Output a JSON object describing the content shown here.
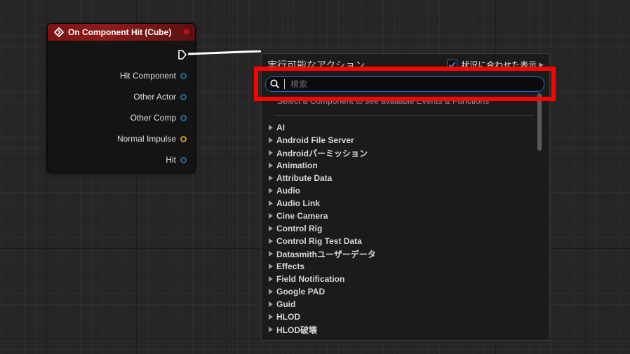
{
  "event_node": {
    "title": "On Component Hit (Cube)",
    "icon": "event-diamond-icon",
    "pins": [
      {
        "label": "Hit Component",
        "type": "object"
      },
      {
        "label": "Other Actor",
        "type": "object"
      },
      {
        "label": "Other Comp",
        "type": "object"
      },
      {
        "label": "Normal Impulse",
        "type": "vector"
      },
      {
        "label": "Hit",
        "type": "struct"
      }
    ]
  },
  "action_menu": {
    "title": "実行可能なアクション",
    "context_sensitive": {
      "label": "状況に合わせた表示",
      "checked": true
    },
    "search": {
      "placeholder": "検索",
      "value": ""
    },
    "hint": "Select a Component to see available Events & Functions",
    "categories": [
      "AI",
      "Android File Server",
      "Androidパーミッション",
      "Animation",
      "Attribute Data",
      "Audio",
      "Audio Link",
      "Cine Camera",
      "Control Rig",
      "Control Rig Test Data",
      "Datasmithユーザーデータ",
      "Effects",
      "Field Notification",
      "Google PAD",
      "Guid",
      "HLOD",
      "HLOD破壊"
    ]
  },
  "colors": {
    "highlight": "#ff0000",
    "node_header": "#8d1c1c",
    "focus_border": "#1f69b5",
    "object_pin": "#1f6f96",
    "vector_pin": "#c6a023"
  }
}
